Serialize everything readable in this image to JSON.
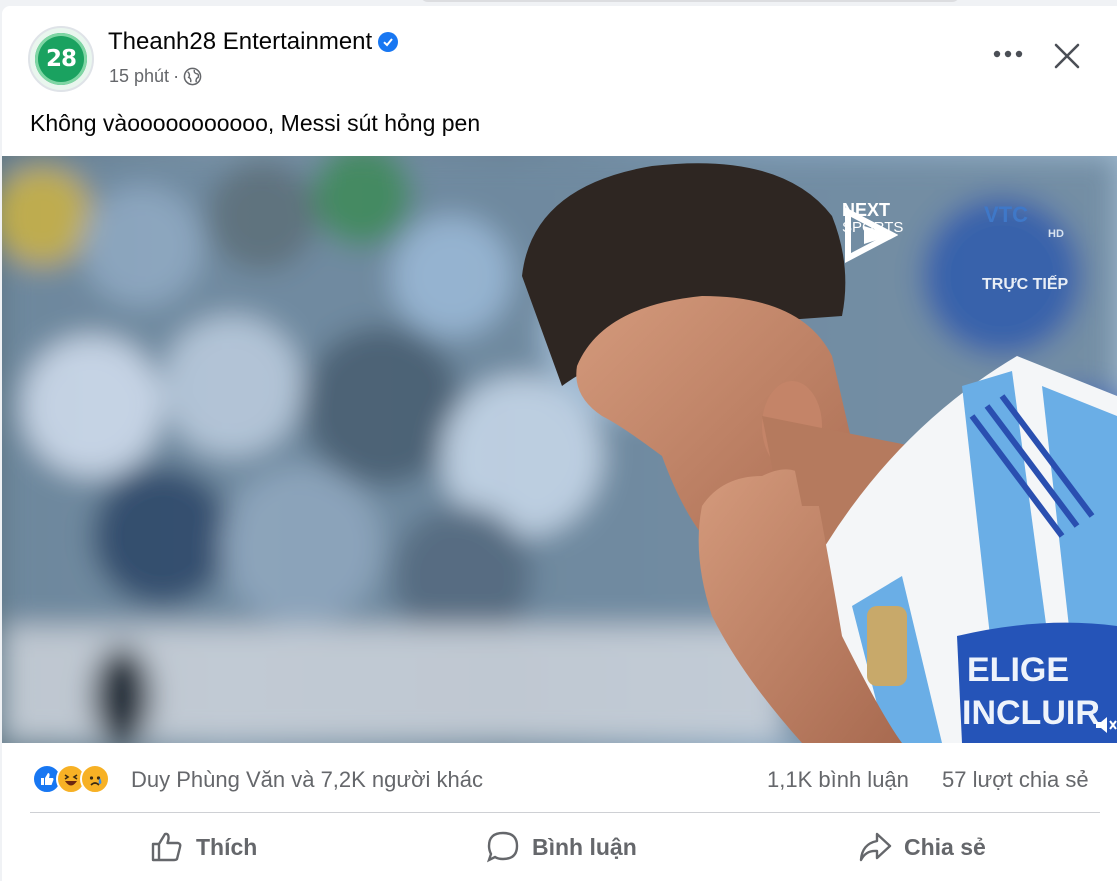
{
  "post": {
    "page_name": "Theanh28 Entertainment",
    "avatar_text": "28",
    "time": "15 phút",
    "separator": "·",
    "caption": "Không vàooooooooooo, Messi sút hỏng pen"
  },
  "video": {
    "broadcaster_top": "NEXT",
    "broadcaster_bottom": "SPORTS",
    "channel": "VTC",
    "quality": "HD",
    "live_label": "TRỰC TIẾP",
    "armband_line1": "ELIGE",
    "armband_line2": "INCLUIR"
  },
  "stats": {
    "reactions": [
      "like-icon",
      "haha-icon",
      "sad-icon"
    ],
    "reaction_text": "Duy Phùng Văn và 7,2K người khác",
    "comments": "1,1K bình luận",
    "shares": "57 lượt chia sẻ"
  },
  "actions": {
    "like": "Thích",
    "comment": "Bình luận",
    "share": "Chia sẻ"
  },
  "colors": {
    "brand_blue": "#1877f2",
    "text_secondary": "#65676b",
    "avatar_green": "#1aa260",
    "jersey_blue": "#6aaee6"
  }
}
